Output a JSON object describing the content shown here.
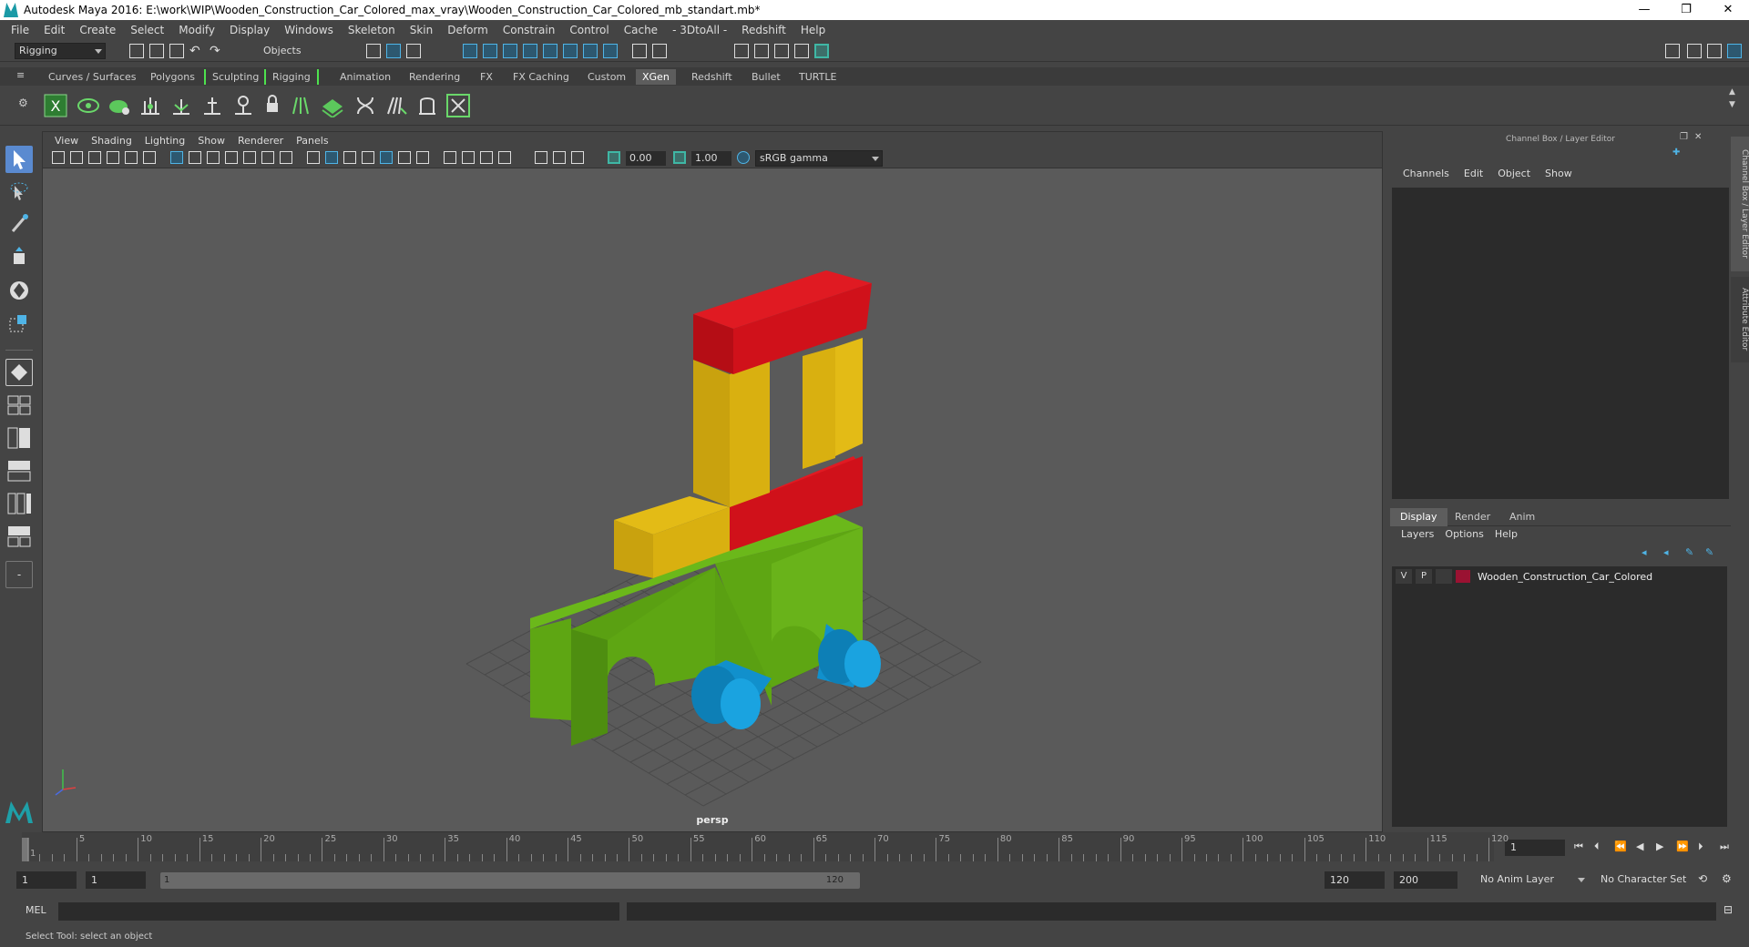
{
  "window": {
    "title": "Autodesk Maya 2016: E:\\work\\WIP\\Wooden_Construction_Car_Colored_max_vray\\Wooden_Construction_Car_Colored_mb_standart.mb*",
    "minimize": "—",
    "restore": "❐",
    "close": "✕"
  },
  "menu": [
    "File",
    "Edit",
    "Create",
    "Select",
    "Modify",
    "Display",
    "Windows",
    "Skeleton",
    "Skin",
    "Deform",
    "Constrain",
    "Control",
    "Cache",
    "- 3DtoAll -",
    "Redshift",
    "Help"
  ],
  "toolbar": {
    "mode": "Rigging",
    "selection_mode": "Objects"
  },
  "shelf_tabs": [
    "Curves / Surfaces",
    "Polygons",
    "Sculpting",
    "Rigging",
    "Animation",
    "Rendering",
    "FX",
    "FX Caching",
    "Custom",
    "XGen",
    "Redshift",
    "Bullet",
    "TURTLE"
  ],
  "shelf_active": "XGen",
  "viewport": {
    "menu": [
      "View",
      "Shading",
      "Lighting",
      "Show",
      "Renderer",
      "Panels"
    ],
    "exposure": "0.00",
    "gamma": "1.00",
    "color_space": "sRGB gamma",
    "camera": "persp",
    "colors": {
      "red": "#d0111a",
      "yellow": "#d9b010",
      "green": "#5ea613",
      "blue": "#1190cc",
      "background": "#5a5a5a"
    }
  },
  "right_panel": {
    "title": "Channel Box / Layer Editor",
    "menu": [
      "Channels",
      "Edit",
      "Object",
      "Show"
    ],
    "tabs": [
      "Display",
      "Render",
      "Anim"
    ],
    "active_tab": "Display",
    "layer_menu": [
      "Layers",
      "Options",
      "Help"
    ],
    "layer": {
      "visible": "V",
      "playback": "P",
      "name": "Wooden_Construction_Car_Colored",
      "color": "#9a1232"
    },
    "side_tabs": [
      "Channel Box / Layer Editor",
      "Attribute Editor"
    ]
  },
  "timeline": {
    "ticks": [
      "1",
      "5",
      "10",
      "15",
      "20",
      "25",
      "30",
      "35",
      "40",
      "45",
      "50",
      "55",
      "60",
      "65",
      "70",
      "75",
      "80",
      "85",
      "90",
      "95",
      "100",
      "105",
      "110",
      "115",
      "120"
    ],
    "current_frame": "1"
  },
  "range": {
    "start": "1",
    "inner_start": "1",
    "bar_start": "1",
    "bar_end": "120",
    "end": "120",
    "total_end": "200",
    "anim_layer": "No Anim Layer",
    "character_set": "No Character Set"
  },
  "mel": {
    "label": "MEL"
  },
  "status": {
    "text": "Select Tool: select an object"
  }
}
